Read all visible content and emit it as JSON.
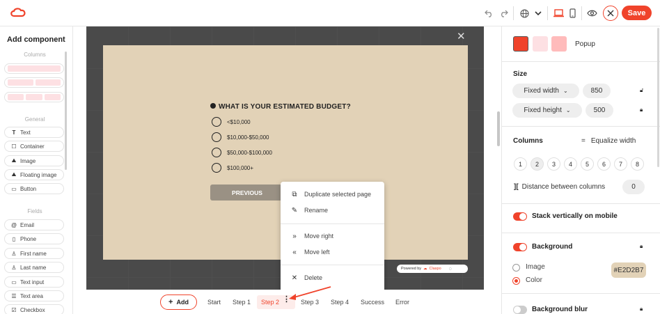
{
  "colors": {
    "accent": "#f0432b",
    "popup_bg": "#E2D2B7",
    "canvas_bg": "#4a4a4a"
  },
  "toolbar": {
    "save_label": "Save",
    "icons": [
      "undo-icon",
      "redo-icon",
      "globe-icon",
      "chevron-down-icon",
      "desktop-icon",
      "mobile-icon",
      "eye-icon",
      "close-icon"
    ]
  },
  "left_panel": {
    "title": "Add component",
    "columns_section": "Columns",
    "general_section": "General",
    "general_items": [
      {
        "label": "Text",
        "icon": "text-icon"
      },
      {
        "label": "Container",
        "icon": "container-icon"
      },
      {
        "label": "Image",
        "icon": "image-icon"
      },
      {
        "label": "Floating image",
        "icon": "floating-image-icon"
      },
      {
        "label": "Button",
        "icon": "button-icon"
      }
    ],
    "fields_section": "Fields",
    "field_items": [
      {
        "label": "Email",
        "icon": "at-icon"
      },
      {
        "label": "Phone",
        "icon": "phone-icon"
      },
      {
        "label": "First name",
        "icon": "person-icon"
      },
      {
        "label": "Last name",
        "icon": "person-icon"
      },
      {
        "label": "Text input",
        "icon": "input-icon"
      },
      {
        "label": "Text area",
        "icon": "textarea-icon"
      },
      {
        "label": "Checkbox",
        "icon": "checkbox-icon"
      }
    ]
  },
  "popup": {
    "question": "WHAT IS YOUR ESTIMATED BUDGET?",
    "options": [
      "<$10,000",
      "$10,000-$50,000",
      "$50,000-$100,000",
      "$100,000+"
    ],
    "previous_label": "PREVIOUS",
    "powered_by": "Powered by",
    "brand": "Claspo"
  },
  "context_menu": {
    "items": [
      {
        "label": "Duplicate selected page",
        "icon": "duplicate-icon"
      },
      {
        "label": "Rename",
        "icon": "pencil-icon"
      },
      {
        "label": "Move right",
        "icon": "double-chevron-right-icon"
      },
      {
        "label": "Move left",
        "icon": "double-chevron-left-icon"
      },
      {
        "label": "Delete",
        "icon": "close-icon"
      }
    ]
  },
  "steps": {
    "add_label": "Add",
    "items": [
      "Start",
      "Step 1",
      "Step 2",
      "Step 3",
      "Step 4",
      "Success",
      "Error"
    ],
    "active": "Step 2"
  },
  "right_panel": {
    "type_label": "Popup",
    "size_label": "Size",
    "width_mode": "Fixed width",
    "width_value": "850",
    "height_mode": "Fixed height",
    "height_value": "500",
    "columns_label": "Columns",
    "equalize_label": "Equalize width",
    "column_numbers": [
      "1",
      "2",
      "3",
      "4",
      "5",
      "6",
      "7",
      "8"
    ],
    "selected_columns": "2",
    "distance_label": "Distance between columns",
    "distance_value": "0",
    "stack_label": "Stack vertically on mobile",
    "background_label": "Background",
    "bg_image_label": "Image",
    "bg_color_label": "Color",
    "bg_color_value": "#E2D2B7",
    "blur_label": "Background blur"
  }
}
